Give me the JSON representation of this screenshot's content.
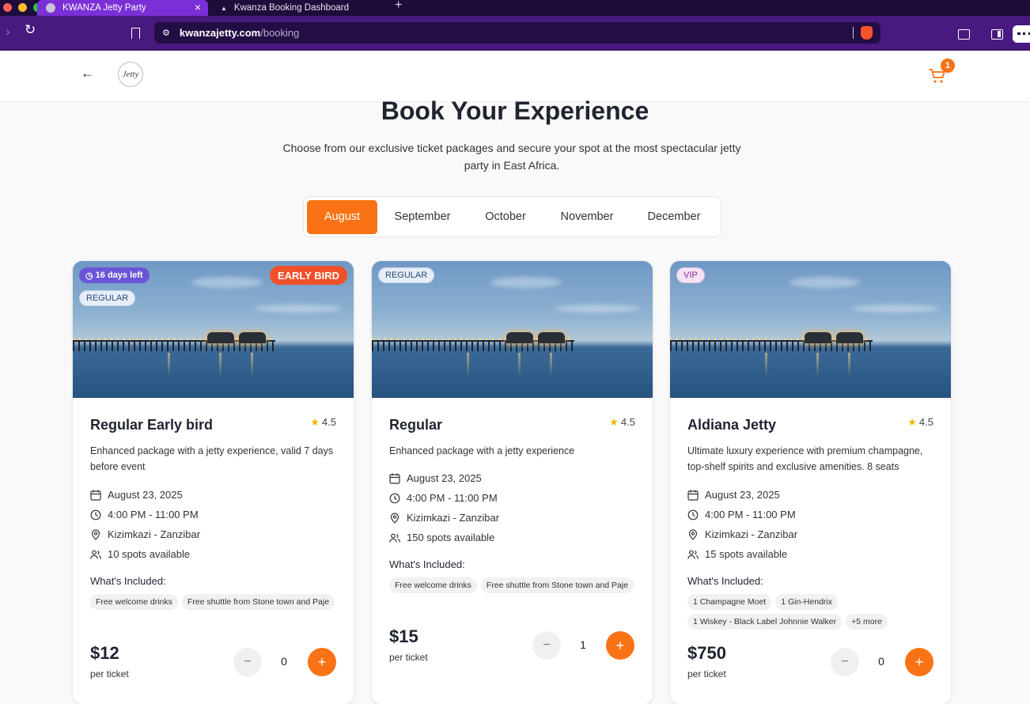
{
  "browser": {
    "tabs": [
      {
        "label": "KWANZA Jetty Party"
      },
      {
        "label": "Kwanza Booking Dashboard"
      }
    ],
    "url_host": "kwanzajetty.com",
    "url_path": "/booking"
  },
  "header": {
    "cart_count": "1"
  },
  "hero": {
    "title": "Book Your Experience",
    "subtitle": "Choose from our exclusive ticket packages and secure your spot at the most spectacular jetty party in East Africa."
  },
  "months": [
    "August",
    "September",
    "October",
    "November",
    "December"
  ],
  "active_month": "August",
  "included_label": "What's Included:",
  "per_ticket_label": "per ticket",
  "cards": [
    {
      "type_badge": "REGULAR",
      "days_left": "16 days left",
      "early_badge": "EARLY BIRD",
      "name": "Regular Early bird",
      "rating": "4.5",
      "description": "Enhanced package with a jetty experience, valid 7 days before event",
      "date": "August 23, 2025",
      "time": "4:00 PM - 11:00 PM",
      "location": "Kizimkazi - Zanzibar",
      "spots": "10 spots available",
      "included": [
        "Free welcome drinks",
        "Free shuttle from Stone town and Paje"
      ],
      "price": "$12",
      "quantity": "0"
    },
    {
      "type_badge": "REGULAR",
      "name": "Regular",
      "rating": "4.5",
      "description": "Enhanced package with a jetty experience",
      "date": "August 23, 2025",
      "time": "4:00 PM - 11:00 PM",
      "location": "Kizimkazi - Zanzibar",
      "spots": "150 spots available",
      "included": [
        "Free welcome drinks",
        "Free shuttle from Stone town and Paje"
      ],
      "price": "$15",
      "quantity": "1"
    },
    {
      "type_badge": "VIP",
      "name": "Aldiana Jetty",
      "rating": "4.5",
      "description": "Ultimate luxury experience with premium champagne, top-shelf spirits and exclusive amenities. 8 seats",
      "date": "August 23, 2025",
      "time": "4:00 PM - 11:00 PM",
      "location": "Kizimkazi - Zanzibar",
      "spots": "15 spots available",
      "included": [
        "1 Champagne Moet",
        "1 Gin-Hendrix",
        "1 Wiskey - Black Label Johnnie Walker",
        "+5 more"
      ],
      "price": "$750",
      "quantity": "0"
    }
  ],
  "colors": {
    "accent": "#f97316",
    "browser_tab": "#7b2fd6",
    "browser_bar": "#48197f"
  }
}
